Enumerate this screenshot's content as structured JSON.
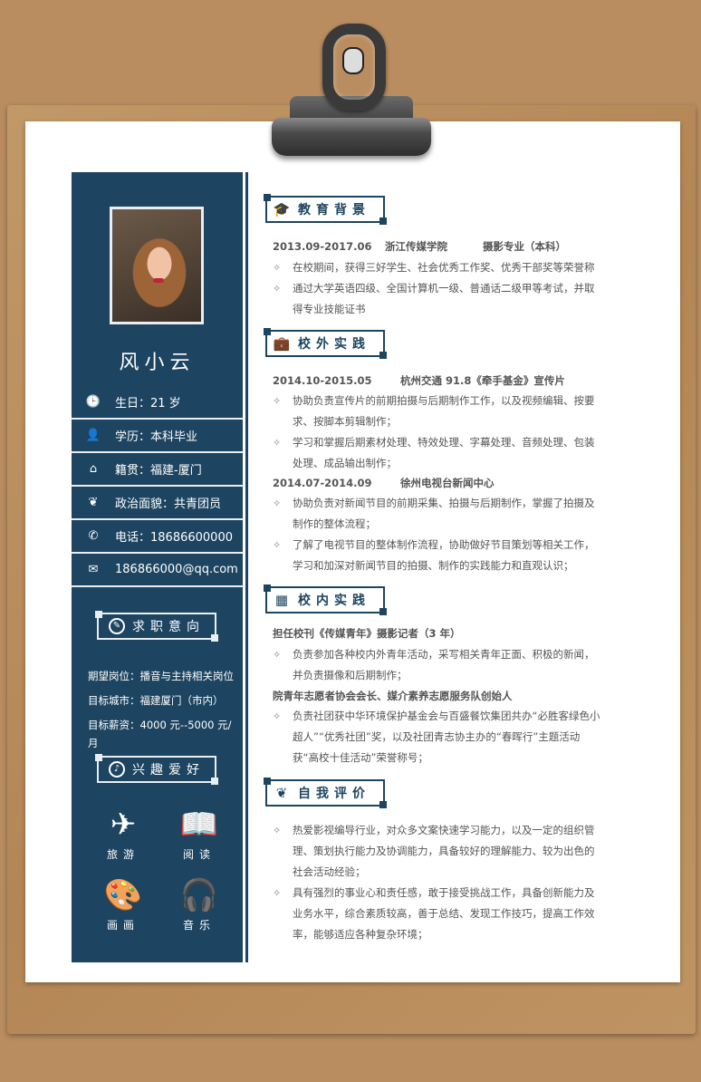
{
  "sidebar": {
    "name": "风小云",
    "info": [
      {
        "icon": "clock-icon",
        "glyph": "🕒",
        "text": "生日：21 岁"
      },
      {
        "icon": "person-icon",
        "glyph": "👤",
        "text": "学历：本科毕业"
      },
      {
        "icon": "home-icon",
        "glyph": "⌂",
        "text": "籍贯：福建-厦门"
      },
      {
        "icon": "leaf-icon",
        "glyph": "❦",
        "text": "政治面貌：共青团员"
      },
      {
        "icon": "phone-icon",
        "glyph": "✆",
        "text": "电话：18686600000"
      },
      {
        "icon": "mail-icon",
        "glyph": "✉",
        "text": "186866000@qq.com"
      }
    ],
    "job_title": "求职意向",
    "goals": [
      "期望岗位：播音与主持相关岗位",
      "目标城市：福建厦门（市内）",
      "目标薪资：4000 元--5000 元/月"
    ],
    "hobby_title": "兴趣爱好",
    "hobbies": [
      {
        "icon": "airplane-icon",
        "glyph": "✈",
        "label": "旅游"
      },
      {
        "icon": "book-icon",
        "glyph": "📖",
        "label": "阅读"
      },
      {
        "icon": "palette-icon",
        "glyph": "🎨",
        "label": "画画"
      },
      {
        "icon": "headphones-icon",
        "glyph": "🎧",
        "label": "音乐"
      }
    ]
  },
  "education": {
    "title": "教育背景",
    "date": "2013.09-2017.06",
    "school": "浙江传媒学院",
    "major": "摄影专业（本科）",
    "bullets": [
      "在校期间，获得三好学生、社会优秀工作奖、优秀干部奖等荣誉称",
      "通过大学英语四级、全国计算机一级、普通话二级甲等考试，并取得专业技能证书"
    ]
  },
  "practice_out": {
    "title": "校外实践",
    "job1_date": "2014.10-2015.05",
    "job1_org": "杭州交通 91.8《牵手基金》宣传片",
    "job1_bullets": [
      "协助负责宣传片的前期拍摄与后期制作工作，以及视频编辑、按要求、按脚本剪辑制作；",
      "学习和掌握后期素材处理、特效处理、字幕处理、音频处理、包装处理、成品输出制作；"
    ],
    "job2_date": "2014.07-2014.09",
    "job2_org": "徐州电视台新闻中心",
    "job2_bullets": [
      "协助负责对新闻节目的前期采集、拍摄与后期制作，掌握了拍摄及制作的整体流程；",
      "了解了电视节目的整体制作流程，协助做好节目策划等相关工作，学习和加深对新闻节目的拍摄、制作的实践能力和直观认识；"
    ]
  },
  "practice_in": {
    "title": "校内实践",
    "role1": "担任校刊《传媒青年》摄影记者（3 年）",
    "role1_bullets": [
      "负责参加各种校内外青年活动，采写相关青年正面、积极的新闻，并负责摄像和后期制作；"
    ],
    "role2": "院青年志愿者协会会长、媒介素养志愿服务队创始人",
    "role2_bullets": [
      "负责社团获中华环境保护基金会与百盛餐饮集团共办“必胜客绿色小超人”“优秀社团”奖，以及社团青志协主办的“春晖行”主题活动获“高校十佳活动”荣誉称号；"
    ]
  },
  "self": {
    "title": "自我评价",
    "bullets": [
      "热爱影视编导行业，对众多文案快速学习能力，以及一定的组织管理、策划执行能力及协调能力，具备较好的理解能力、较为出色的社会活动经验；",
      "具有强烈的事业心和责任感，敢于接受挑战工作，具备创新能力及业务水平，综合素质较高，善于总结、发现工作技巧，提高工作效率，能够适应各种复杂环境；"
    ]
  }
}
